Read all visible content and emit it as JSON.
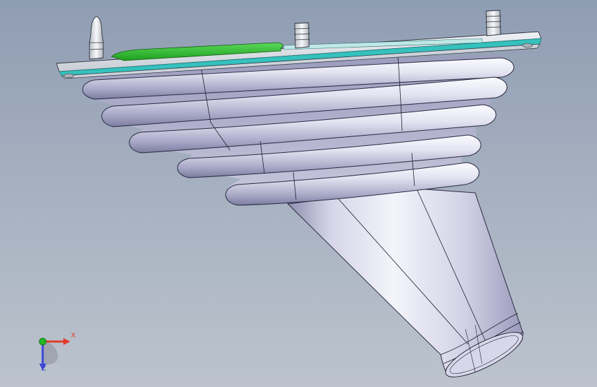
{
  "viewport": {
    "background_top": "#8f9db3",
    "background_bottom": "#bcc3cd"
  },
  "model": {
    "body_color": "#d9d9ea",
    "plate_color": "#dadfe6",
    "plate_edge_color": "#35c1bd",
    "pcb_color": "#2dbb2d",
    "bellows_rings": 5
  },
  "triad": {
    "x_label": "X",
    "z_label": "Z",
    "x_color": "#e23a2a",
    "y_color": "#1fb81f",
    "z_color": "#3a45d8"
  }
}
